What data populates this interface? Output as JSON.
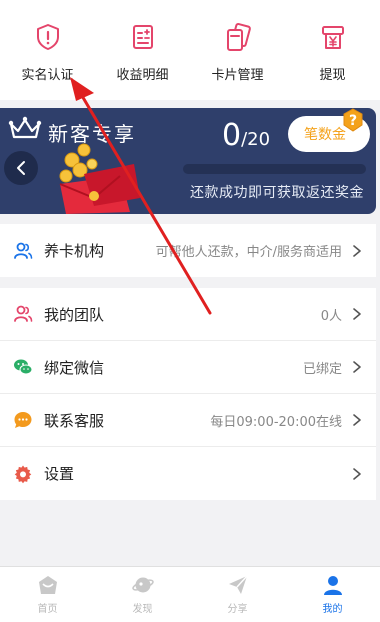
{
  "quick_actions": [
    {
      "label": "实名认证",
      "icon": "shield-alert-icon"
    },
    {
      "label": "收益明细",
      "icon": "ledger-icon"
    },
    {
      "label": "卡片管理",
      "icon": "card-icon"
    },
    {
      "label": "提现",
      "icon": "yen-withdraw-icon"
    }
  ],
  "banner": {
    "title": "新客专享",
    "count_current": "0",
    "count_total": "/20",
    "pill_label": "笔数金",
    "progress": 0,
    "subtitle": "还款成功即可获取返还奖金"
  },
  "section1": [
    {
      "name": "养卡机构",
      "value": "可帮他人还款，中介/服务商适用",
      "icon": "users-icon"
    }
  ],
  "section2": [
    {
      "name": "我的团队",
      "value": "0人",
      "icon": "user-group-icon"
    },
    {
      "name": "绑定微信",
      "value": "已绑定",
      "icon": "wechat-icon"
    },
    {
      "name": "联系客服",
      "value": "每日09:00-20:00在线",
      "icon": "chat-bubble-icon"
    },
    {
      "name": "设置",
      "value": "",
      "icon": "gear-icon"
    }
  ],
  "bottom_nav": [
    {
      "label": "首页",
      "icon": "home-icon"
    },
    {
      "label": "发现",
      "icon": "planet-icon"
    },
    {
      "label": "分享",
      "icon": "paper-plane-icon"
    },
    {
      "label": "我的",
      "icon": "person-icon",
      "active": true
    }
  ],
  "colors": {
    "accent_pink": "#e4456b",
    "banner_bg": "#2f3f6b",
    "gold": "#f4a21b",
    "active_blue": "#1a73e8",
    "arrow_red": "#e02020"
  }
}
